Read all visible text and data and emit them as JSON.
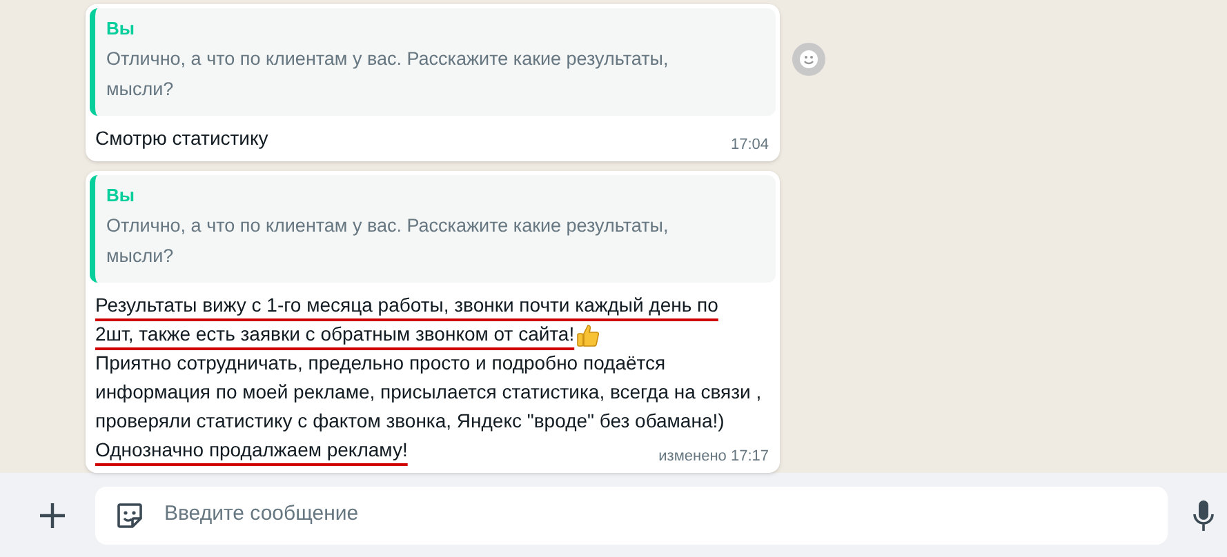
{
  "messages": [
    {
      "quote": {
        "author": "Вы",
        "text": "Отлично, а что по клиентам у вас. Расскажите какие результаты, мысли?"
      },
      "lines": [
        {
          "text": "Смотрю статистику",
          "underlined": false,
          "thumbs_up": false
        }
      ],
      "meta": "17:04",
      "reaction_button": true
    },
    {
      "quote": {
        "author": "Вы",
        "text": "Отлично, а что по клиентам у вас. Расскажите какие результаты, мысли?"
      },
      "lines": [
        {
          "text": "Результаты вижу с 1-го месяца работы, звонки почти каждый день по",
          "underlined": true,
          "thumbs_up": false
        },
        {
          "text": "2шт, также есть заявки с обратным звонком от сайта!",
          "underlined": true,
          "thumbs_up": true
        },
        {
          "text": "Приятно сотрудничать, предельно просто и подробно подаётся",
          "underlined": false,
          "thumbs_up": false
        },
        {
          "text": "информация по моей рекламе, присылается статистика, всегда на связи ,",
          "underlined": false,
          "thumbs_up": false
        },
        {
          "text": "проверяли статистику с фактом звонка, Яндекс \"вроде\" без обамана!)",
          "underlined": false,
          "thumbs_up": false
        },
        {
          "text": "Однозначно продалжаем рекламу!",
          "underlined": true,
          "thumbs_up": false
        }
      ],
      "meta": "изменено 17:17",
      "reaction_button": false
    }
  ],
  "composer": {
    "placeholder": "Введите сообщение"
  }
}
